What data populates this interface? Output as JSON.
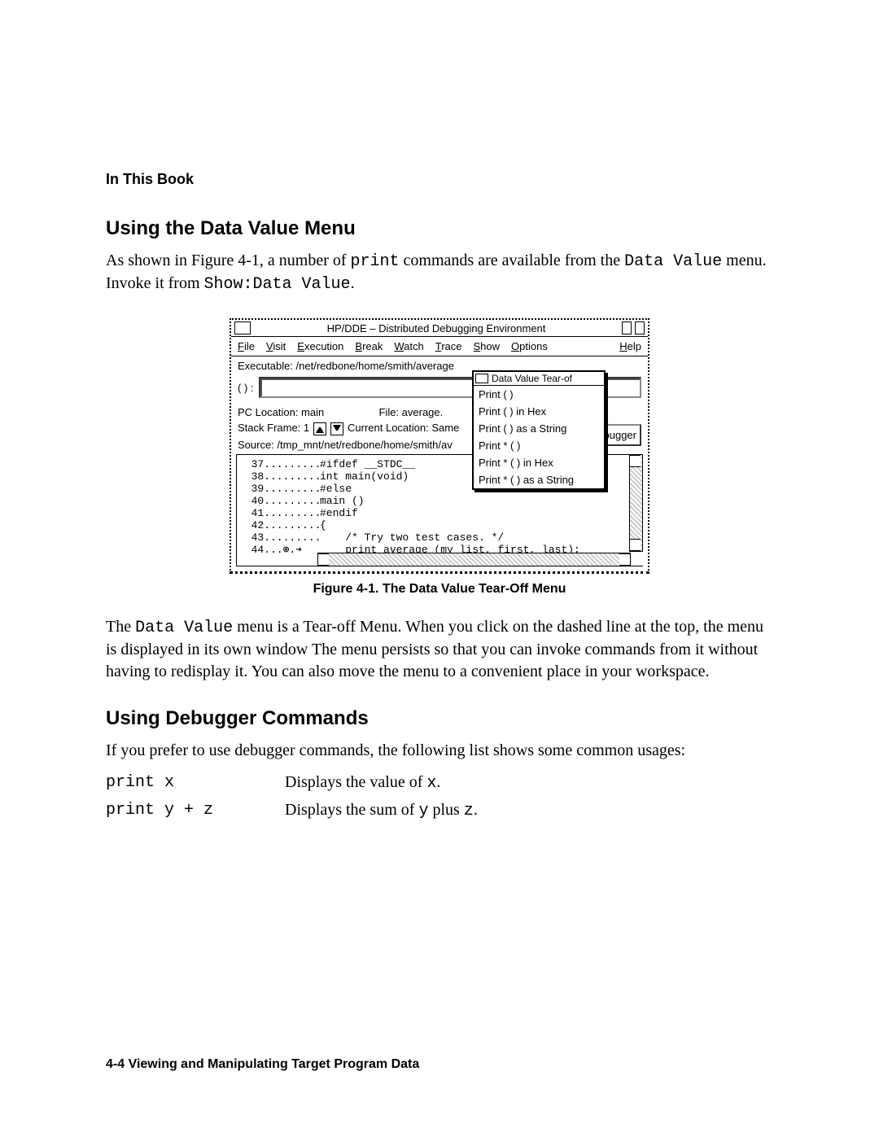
{
  "header": {
    "book": "In This Book"
  },
  "section1": {
    "title": "Using the Data Value Menu",
    "p1a": "As shown in Figure 4-1, a number of ",
    "p1b": "print",
    "p1c": " commands are available from the ",
    "p1d": "Data Value",
    "p1e": " menu. Invoke it from ",
    "p1f": "Show:Data Value",
    "p1g": "."
  },
  "figure": {
    "caption": "Figure 4-1. The Data Value Tear-Off Menu",
    "window": {
      "title": "HP/DDE  –  Distributed Debugging Environment",
      "menus": {
        "file": "File",
        "visit": "Visit",
        "execution": "Execution",
        "break": "Break",
        "watch": "Watch",
        "trace": "Trace",
        "show": "Show",
        "options": "Options",
        "help": "Help"
      },
      "executable": "Executable: /net/redbone/home/smith/average",
      "paren": "( ) :",
      "pc_location": "PC Location: main",
      "file_label": "File: average.",
      "stack_frame": "Stack Frame: 1",
      "current_loc": "Current Location: Same",
      "source": "Source: /tmp_mnt/net/redbone/home/smith/av",
      "side_button": "t Debugger",
      "tearoff": {
        "title": "Data Value Tear-of",
        "items": [
          "Print ( )",
          "Print ( ) in Hex",
          "Print ( ) as a String",
          "Print * ( )",
          "Print * ( ) in Hex",
          "Print * ( ) as a String"
        ]
      },
      "code_lines": [
        {
          "n": "37",
          "t": "#ifdef __STDC__"
        },
        {
          "n": "38",
          "t": "int main(void)"
        },
        {
          "n": "39",
          "t": "#else"
        },
        {
          "n": "40",
          "t": "main ()"
        },
        {
          "n": "41",
          "t": "#endif"
        },
        {
          "n": "42",
          "t": "{"
        },
        {
          "n": "43",
          "t": "    /* Try two test cases. */"
        },
        {
          "n": "44",
          "t": "    print_average (my_list, first, last);",
          "mark": "⊛.➔"
        }
      ]
    }
  },
  "afterfig": {
    "a": "The ",
    "b": "Data Value",
    "c": " menu is a Tear-off Menu. When you click on the dashed line at the top, the menu is displayed in its own window The menu persists so that you can invoke commands from it without having to redisplay it. You can also move the menu to a convenient place in your workspace."
  },
  "section2": {
    "title": "Using Debugger Commands",
    "intro": "If you prefer to use debugger commands, the following list shows some common usages:",
    "rows": [
      {
        "cmd": "print x",
        "d1": "Displays the value of ",
        "d2": "x",
        "d3": "."
      },
      {
        "cmd": "print y + z",
        "d1": "Displays the sum of ",
        "d2": "y",
        "d3": " plus ",
        "d4": "z",
        "d5": "."
      }
    ]
  },
  "footer": "4-4   Viewing and Manipulating Target Program Data"
}
